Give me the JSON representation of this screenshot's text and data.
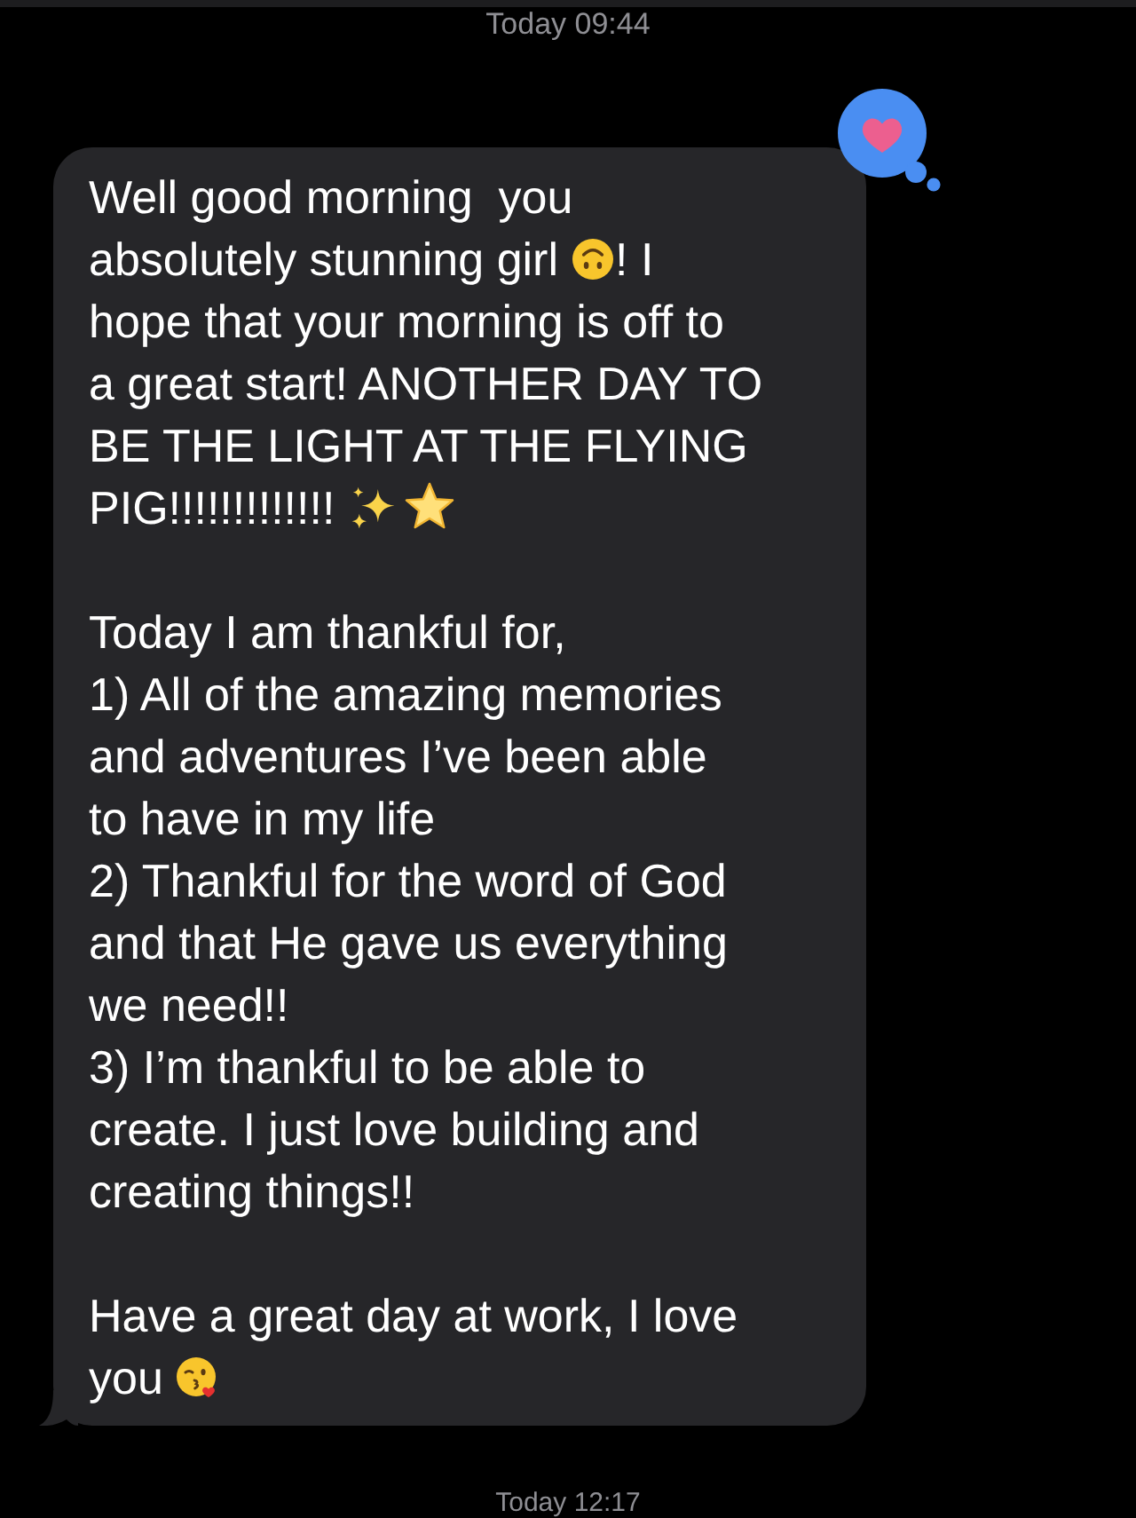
{
  "timestamp_top": "Today 09:44",
  "message": {
    "paragraphs": [
      {
        "lines": [
          [
            {
              "kind": "text",
              "text": "Well good morning  you"
            }
          ],
          [
            {
              "kind": "text",
              "text": "absolutely stunning girl"
            },
            {
              "kind": "upsidedown"
            },
            {
              "kind": "text",
              "text": "! I"
            }
          ],
          [
            {
              "kind": "text",
              "text": "hope that your morning is off to"
            }
          ],
          [
            {
              "kind": "text",
              "text": "a great start! ANOTHER DAY TO"
            }
          ],
          [
            {
              "kind": "text",
              "text": "BE THE LIGHT AT THE FLYING"
            }
          ],
          [
            {
              "kind": "text",
              "text": "PIG!!!!!!!!!!!!!"
            },
            {
              "kind": "sparkles"
            },
            {
              "kind": "star"
            }
          ]
        ]
      },
      {
        "lines": [
          [
            {
              "kind": "text",
              "text": "Today I am thankful for,"
            }
          ],
          [
            {
              "kind": "text",
              "text": "1) All of the amazing memories"
            }
          ],
          [
            {
              "kind": "text",
              "text": "and adventures I’ve been able"
            }
          ],
          [
            {
              "kind": "text",
              "text": "to have in my life"
            }
          ],
          [
            {
              "kind": "text",
              "text": "2) Thankful for the word of God"
            }
          ],
          [
            {
              "kind": "text",
              "text": "and that He gave us everything"
            }
          ],
          [
            {
              "kind": "text",
              "text": "we need!!"
            }
          ],
          [
            {
              "kind": "text",
              "text": "3) I’m thankful to be able to"
            }
          ],
          [
            {
              "kind": "text",
              "text": "create. I just love building and"
            }
          ],
          [
            {
              "kind": "text",
              "text": "creating things!!"
            }
          ]
        ]
      },
      {
        "lines": [
          [
            {
              "kind": "text",
              "text": "Have a great day at work, I love"
            }
          ],
          [
            {
              "kind": "text",
              "text": "you"
            },
            {
              "kind": "kiss"
            }
          ]
        ]
      }
    ]
  },
  "timestamp_bottom": "Today 12:17"
}
